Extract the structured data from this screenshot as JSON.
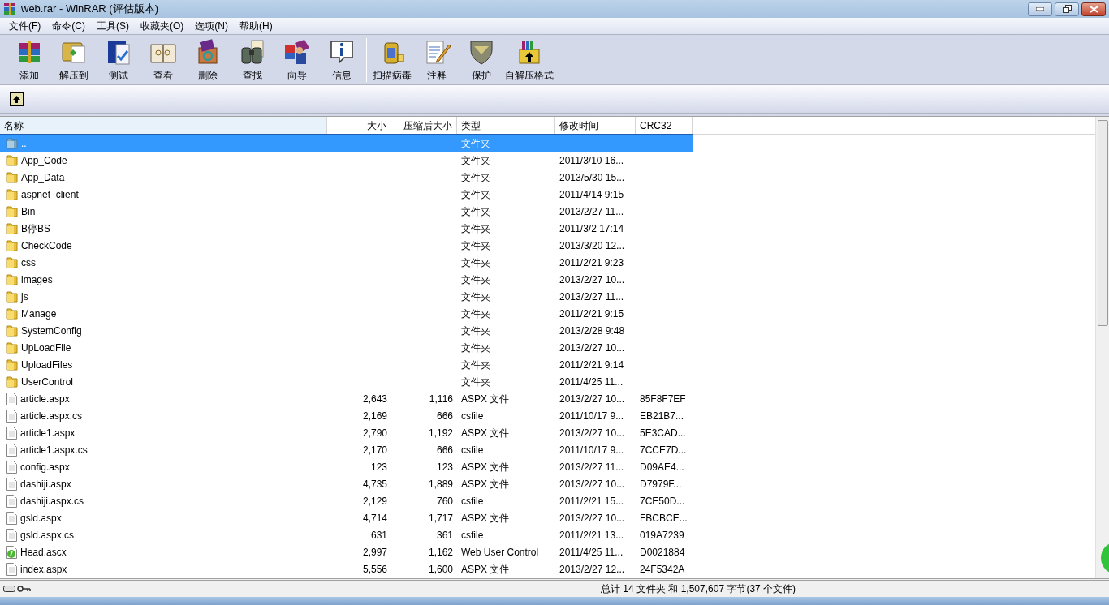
{
  "window": {
    "title": "web.rar - WinRAR (评估版本)"
  },
  "menu": [
    "文件(F)",
    "命令(C)",
    "工具(S)",
    "收藏夹(O)",
    "选项(N)",
    "帮助(H)"
  ],
  "toolbar": [
    {
      "label": "添加"
    },
    {
      "label": "解压到"
    },
    {
      "label": "测试"
    },
    {
      "label": "查看"
    },
    {
      "label": "删除"
    },
    {
      "label": "查找"
    },
    {
      "label": "向导"
    },
    {
      "label": "信息"
    },
    {
      "label": "扫描病毒",
      "separator_before": true
    },
    {
      "label": "注释"
    },
    {
      "label": "保护"
    },
    {
      "label": "自解压格式"
    }
  ],
  "table": {
    "columns": [
      "名称",
      "大小",
      "压缩后大小",
      "类型",
      "修改时间",
      "CRC32"
    ],
    "rows": [
      {
        "kind": "parent",
        "name": "..",
        "size": "",
        "packed": "",
        "type": "文件夹",
        "modified": "",
        "crc": "",
        "selected": true
      },
      {
        "kind": "folder",
        "name": "App_Code",
        "size": "",
        "packed": "",
        "type": "文件夹",
        "modified": "2011/3/10 16...",
        "crc": "",
        "selected": false
      },
      {
        "kind": "folder",
        "name": "App_Data",
        "size": "",
        "packed": "",
        "type": "文件夹",
        "modified": "2013/5/30 15...",
        "crc": "",
        "selected": false
      },
      {
        "kind": "folder",
        "name": "aspnet_client",
        "size": "",
        "packed": "",
        "type": "文件夹",
        "modified": "2011/4/14 9:15",
        "crc": "",
        "selected": false
      },
      {
        "kind": "folder",
        "name": "Bin",
        "size": "",
        "packed": "",
        "type": "文件夹",
        "modified": "2013/2/27 11...",
        "crc": "",
        "selected": false
      },
      {
        "kind": "folder",
        "name": "B停BS",
        "size": "",
        "packed": "",
        "type": "文件夹",
        "modified": "2011/3/2 17:14",
        "crc": "",
        "selected": false
      },
      {
        "kind": "folder",
        "name": "CheckCode",
        "size": "",
        "packed": "",
        "type": "文件夹",
        "modified": "2013/3/20 12...",
        "crc": "",
        "selected": false
      },
      {
        "kind": "folder",
        "name": "css",
        "size": "",
        "packed": "",
        "type": "文件夹",
        "modified": "2011/2/21 9:23",
        "crc": "",
        "selected": false
      },
      {
        "kind": "folder",
        "name": "images",
        "size": "",
        "packed": "",
        "type": "文件夹",
        "modified": "2013/2/27 10...",
        "crc": "",
        "selected": false
      },
      {
        "kind": "folder",
        "name": "js",
        "size": "",
        "packed": "",
        "type": "文件夹",
        "modified": "2013/2/27 11...",
        "crc": "",
        "selected": false
      },
      {
        "kind": "folder",
        "name": "Manage",
        "size": "",
        "packed": "",
        "type": "文件夹",
        "modified": "2011/2/21 9:15",
        "crc": "",
        "selected": false
      },
      {
        "kind": "folder",
        "name": "SystemConfig",
        "size": "",
        "packed": "",
        "type": "文件夹",
        "modified": "2013/2/28 9:48",
        "crc": "",
        "selected": false
      },
      {
        "kind": "folder",
        "name": "UpLoadFile",
        "size": "",
        "packed": "",
        "type": "文件夹",
        "modified": "2013/2/27 10...",
        "crc": "",
        "selected": false
      },
      {
        "kind": "folder",
        "name": "UploadFiles",
        "size": "",
        "packed": "",
        "type": "文件夹",
        "modified": "2011/2/21 9:14",
        "crc": "",
        "selected": false
      },
      {
        "kind": "folder",
        "name": "UserControl",
        "size": "",
        "packed": "",
        "type": "文件夹",
        "modified": "2011/4/25 11...",
        "crc": "",
        "selected": false
      },
      {
        "kind": "file",
        "name": "article.aspx",
        "size": "2,643",
        "packed": "1,116",
        "type": "ASPX 文件",
        "modified": "2013/2/27 10...",
        "crc": "85F8F7EF",
        "selected": false
      },
      {
        "kind": "file",
        "name": "article.aspx.cs",
        "size": "2,169",
        "packed": "666",
        "type": "csfile",
        "modified": "2011/10/17 9...",
        "crc": "EB21B7...",
        "selected": false
      },
      {
        "kind": "file",
        "name": "article1.aspx",
        "size": "2,790",
        "packed": "1,192",
        "type": "ASPX 文件",
        "modified": "2013/2/27 10...",
        "crc": "5E3CAD...",
        "selected": false
      },
      {
        "kind": "file",
        "name": "article1.aspx.cs",
        "size": "2,170",
        "packed": "666",
        "type": "csfile",
        "modified": "2011/10/17 9...",
        "crc": "7CCE7D...",
        "selected": false
      },
      {
        "kind": "file",
        "name": "config.aspx",
        "size": "123",
        "packed": "123",
        "type": "ASPX 文件",
        "modified": "2013/2/27 11...",
        "crc": "D09AE4...",
        "selected": false
      },
      {
        "kind": "file",
        "name": "dashiji.aspx",
        "size": "4,735",
        "packed": "1,889",
        "type": "ASPX 文件",
        "modified": "2013/2/27 10...",
        "crc": "D7979F...",
        "selected": false
      },
      {
        "kind": "file",
        "name": "dashiji.aspx.cs",
        "size": "2,129",
        "packed": "760",
        "type": "csfile",
        "modified": "2011/2/21 15...",
        "crc": "7CE50D...",
        "selected": false
      },
      {
        "kind": "file",
        "name": "gsld.aspx",
        "size": "4,714",
        "packed": "1,717",
        "type": "ASPX 文件",
        "modified": "2013/2/27 10...",
        "crc": "FBCBCE...",
        "selected": false
      },
      {
        "kind": "file",
        "name": "gsld.aspx.cs",
        "size": "631",
        "packed": "361",
        "type": "csfile",
        "modified": "2011/2/21 13...",
        "crc": "019A7239",
        "selected": false
      },
      {
        "kind": "control",
        "name": "Head.ascx",
        "size": "2,997",
        "packed": "1,162",
        "type": "Web User Control",
        "modified": "2011/4/25 11...",
        "crc": "D0021884",
        "selected": false
      },
      {
        "kind": "file",
        "name": "index.aspx",
        "size": "5,556",
        "packed": "1,600",
        "type": "ASPX 文件",
        "modified": "2013/2/27 12...",
        "crc": "24F5342A",
        "selected": false
      }
    ]
  },
  "status_bar": {
    "summary": "总计 14 文件夹 和 1,507,607 字节(37 个文件)"
  }
}
